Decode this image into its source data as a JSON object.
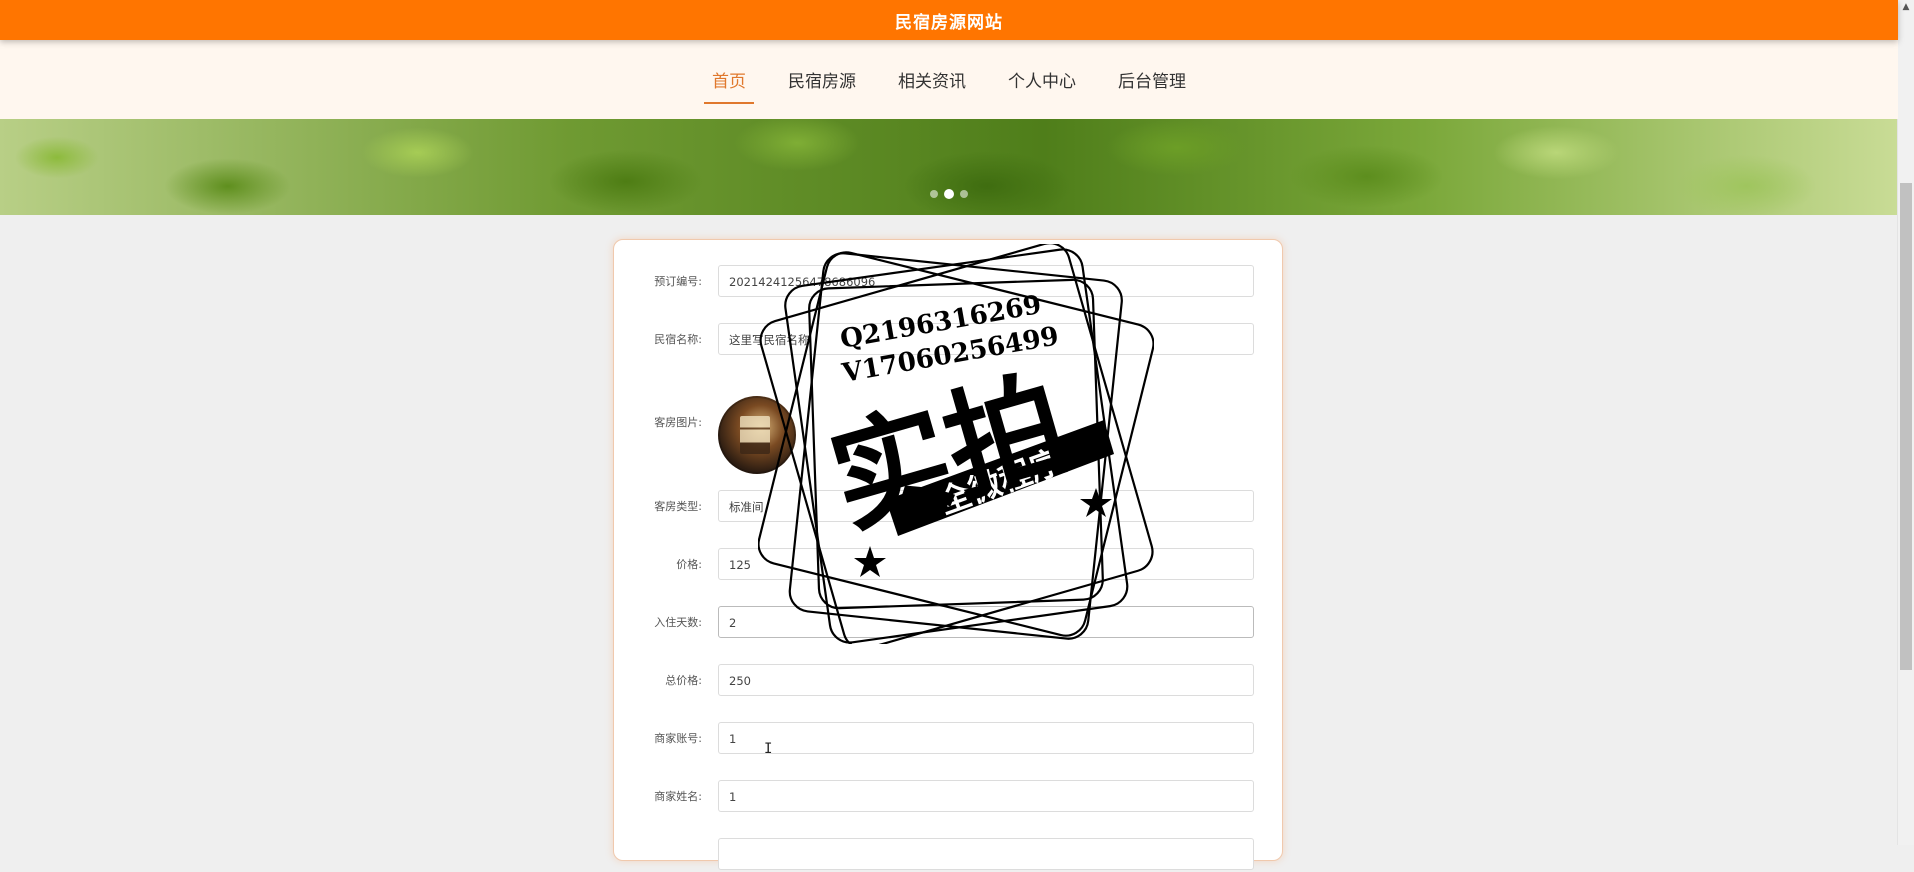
{
  "header": {
    "title": "民宿房源网站"
  },
  "nav": {
    "items": [
      "首页",
      "民宿房源",
      "相关资讯",
      "个人中心",
      "后台管理"
    ],
    "active_index": 0
  },
  "banner": {
    "dots": 3,
    "active_dot": 1
  },
  "form": {
    "booking_no": {
      "label": "预订编号:",
      "value": "20214241256478686096"
    },
    "homestay_name": {
      "label": "民宿名称:",
      "value": "这里写民宿名称"
    },
    "room_image": {
      "label": "客房图片:"
    },
    "room_type": {
      "label": "客房类型:",
      "value": "标准间"
    },
    "price": {
      "label": "价格:",
      "value": "125"
    },
    "days": {
      "label": "入住天数:",
      "value": "2"
    },
    "total": {
      "label": "总价格:",
      "value": "250"
    },
    "merchant_account": {
      "label": "商家账号:",
      "value": "1"
    },
    "merchant_name": {
      "label": "商家姓名:",
      "value": "1"
    }
  },
  "stamp": {
    "qq": "Q2196316269",
    "wx": "V17060256499",
    "main": "实拍",
    "ribbon": "全微程序"
  },
  "colors": {
    "primary": "#ff7500",
    "nav_bg": "#fff7ef",
    "active": "#e0782c"
  },
  "icons": {
    "cursor": "text-cursor-icon",
    "scroll_up": "arrow-up-icon"
  }
}
